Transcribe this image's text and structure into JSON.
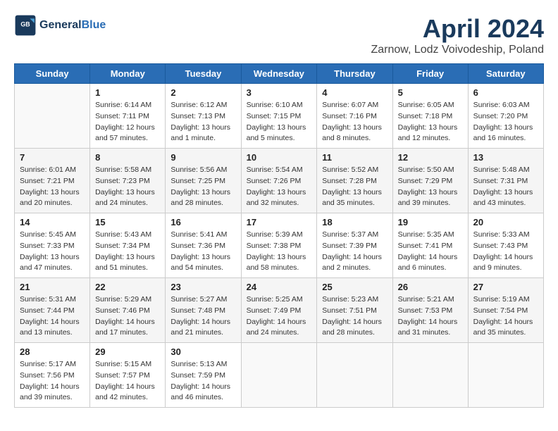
{
  "header": {
    "logo_line1": "General",
    "logo_line2": "Blue",
    "month_year": "April 2024",
    "location": "Zarnow, Lodz Voivodeship, Poland"
  },
  "weekdays": [
    "Sunday",
    "Monday",
    "Tuesday",
    "Wednesday",
    "Thursday",
    "Friday",
    "Saturday"
  ],
  "weeks": [
    [
      {
        "day": "",
        "sunrise": "",
        "sunset": "",
        "daylight": ""
      },
      {
        "day": "1",
        "sunrise": "Sunrise: 6:14 AM",
        "sunset": "Sunset: 7:11 PM",
        "daylight": "Daylight: 12 hours and 57 minutes."
      },
      {
        "day": "2",
        "sunrise": "Sunrise: 6:12 AM",
        "sunset": "Sunset: 7:13 PM",
        "daylight": "Daylight: 13 hours and 1 minute."
      },
      {
        "day": "3",
        "sunrise": "Sunrise: 6:10 AM",
        "sunset": "Sunset: 7:15 PM",
        "daylight": "Daylight: 13 hours and 5 minutes."
      },
      {
        "day": "4",
        "sunrise": "Sunrise: 6:07 AM",
        "sunset": "Sunset: 7:16 PM",
        "daylight": "Daylight: 13 hours and 8 minutes."
      },
      {
        "day": "5",
        "sunrise": "Sunrise: 6:05 AM",
        "sunset": "Sunset: 7:18 PM",
        "daylight": "Daylight: 13 hours and 12 minutes."
      },
      {
        "day": "6",
        "sunrise": "Sunrise: 6:03 AM",
        "sunset": "Sunset: 7:20 PM",
        "daylight": "Daylight: 13 hours and 16 minutes."
      }
    ],
    [
      {
        "day": "7",
        "sunrise": "Sunrise: 6:01 AM",
        "sunset": "Sunset: 7:21 PM",
        "daylight": "Daylight: 13 hours and 20 minutes."
      },
      {
        "day": "8",
        "sunrise": "Sunrise: 5:58 AM",
        "sunset": "Sunset: 7:23 PM",
        "daylight": "Daylight: 13 hours and 24 minutes."
      },
      {
        "day": "9",
        "sunrise": "Sunrise: 5:56 AM",
        "sunset": "Sunset: 7:25 PM",
        "daylight": "Daylight: 13 hours and 28 minutes."
      },
      {
        "day": "10",
        "sunrise": "Sunrise: 5:54 AM",
        "sunset": "Sunset: 7:26 PM",
        "daylight": "Daylight: 13 hours and 32 minutes."
      },
      {
        "day": "11",
        "sunrise": "Sunrise: 5:52 AM",
        "sunset": "Sunset: 7:28 PM",
        "daylight": "Daylight: 13 hours and 35 minutes."
      },
      {
        "day": "12",
        "sunrise": "Sunrise: 5:50 AM",
        "sunset": "Sunset: 7:29 PM",
        "daylight": "Daylight: 13 hours and 39 minutes."
      },
      {
        "day": "13",
        "sunrise": "Sunrise: 5:48 AM",
        "sunset": "Sunset: 7:31 PM",
        "daylight": "Daylight: 13 hours and 43 minutes."
      }
    ],
    [
      {
        "day": "14",
        "sunrise": "Sunrise: 5:45 AM",
        "sunset": "Sunset: 7:33 PM",
        "daylight": "Daylight: 13 hours and 47 minutes."
      },
      {
        "day": "15",
        "sunrise": "Sunrise: 5:43 AM",
        "sunset": "Sunset: 7:34 PM",
        "daylight": "Daylight: 13 hours and 51 minutes."
      },
      {
        "day": "16",
        "sunrise": "Sunrise: 5:41 AM",
        "sunset": "Sunset: 7:36 PM",
        "daylight": "Daylight: 13 hours and 54 minutes."
      },
      {
        "day": "17",
        "sunrise": "Sunrise: 5:39 AM",
        "sunset": "Sunset: 7:38 PM",
        "daylight": "Daylight: 13 hours and 58 minutes."
      },
      {
        "day": "18",
        "sunrise": "Sunrise: 5:37 AM",
        "sunset": "Sunset: 7:39 PM",
        "daylight": "Daylight: 14 hours and 2 minutes."
      },
      {
        "day": "19",
        "sunrise": "Sunrise: 5:35 AM",
        "sunset": "Sunset: 7:41 PM",
        "daylight": "Daylight: 14 hours and 6 minutes."
      },
      {
        "day": "20",
        "sunrise": "Sunrise: 5:33 AM",
        "sunset": "Sunset: 7:43 PM",
        "daylight": "Daylight: 14 hours and 9 minutes."
      }
    ],
    [
      {
        "day": "21",
        "sunrise": "Sunrise: 5:31 AM",
        "sunset": "Sunset: 7:44 PM",
        "daylight": "Daylight: 14 hours and 13 minutes."
      },
      {
        "day": "22",
        "sunrise": "Sunrise: 5:29 AM",
        "sunset": "Sunset: 7:46 PM",
        "daylight": "Daylight: 14 hours and 17 minutes."
      },
      {
        "day": "23",
        "sunrise": "Sunrise: 5:27 AM",
        "sunset": "Sunset: 7:48 PM",
        "daylight": "Daylight: 14 hours and 21 minutes."
      },
      {
        "day": "24",
        "sunrise": "Sunrise: 5:25 AM",
        "sunset": "Sunset: 7:49 PM",
        "daylight": "Daylight: 14 hours and 24 minutes."
      },
      {
        "day": "25",
        "sunrise": "Sunrise: 5:23 AM",
        "sunset": "Sunset: 7:51 PM",
        "daylight": "Daylight: 14 hours and 28 minutes."
      },
      {
        "day": "26",
        "sunrise": "Sunrise: 5:21 AM",
        "sunset": "Sunset: 7:53 PM",
        "daylight": "Daylight: 14 hours and 31 minutes."
      },
      {
        "day": "27",
        "sunrise": "Sunrise: 5:19 AM",
        "sunset": "Sunset: 7:54 PM",
        "daylight": "Daylight: 14 hours and 35 minutes."
      }
    ],
    [
      {
        "day": "28",
        "sunrise": "Sunrise: 5:17 AM",
        "sunset": "Sunset: 7:56 PM",
        "daylight": "Daylight: 14 hours and 39 minutes."
      },
      {
        "day": "29",
        "sunrise": "Sunrise: 5:15 AM",
        "sunset": "Sunset: 7:57 PM",
        "daylight": "Daylight: 14 hours and 42 minutes."
      },
      {
        "day": "30",
        "sunrise": "Sunrise: 5:13 AM",
        "sunset": "Sunset: 7:59 PM",
        "daylight": "Daylight: 14 hours and 46 minutes."
      },
      {
        "day": "",
        "sunrise": "",
        "sunset": "",
        "daylight": ""
      },
      {
        "day": "",
        "sunrise": "",
        "sunset": "",
        "daylight": ""
      },
      {
        "day": "",
        "sunrise": "",
        "sunset": "",
        "daylight": ""
      },
      {
        "day": "",
        "sunrise": "",
        "sunset": "",
        "daylight": ""
      }
    ]
  ]
}
